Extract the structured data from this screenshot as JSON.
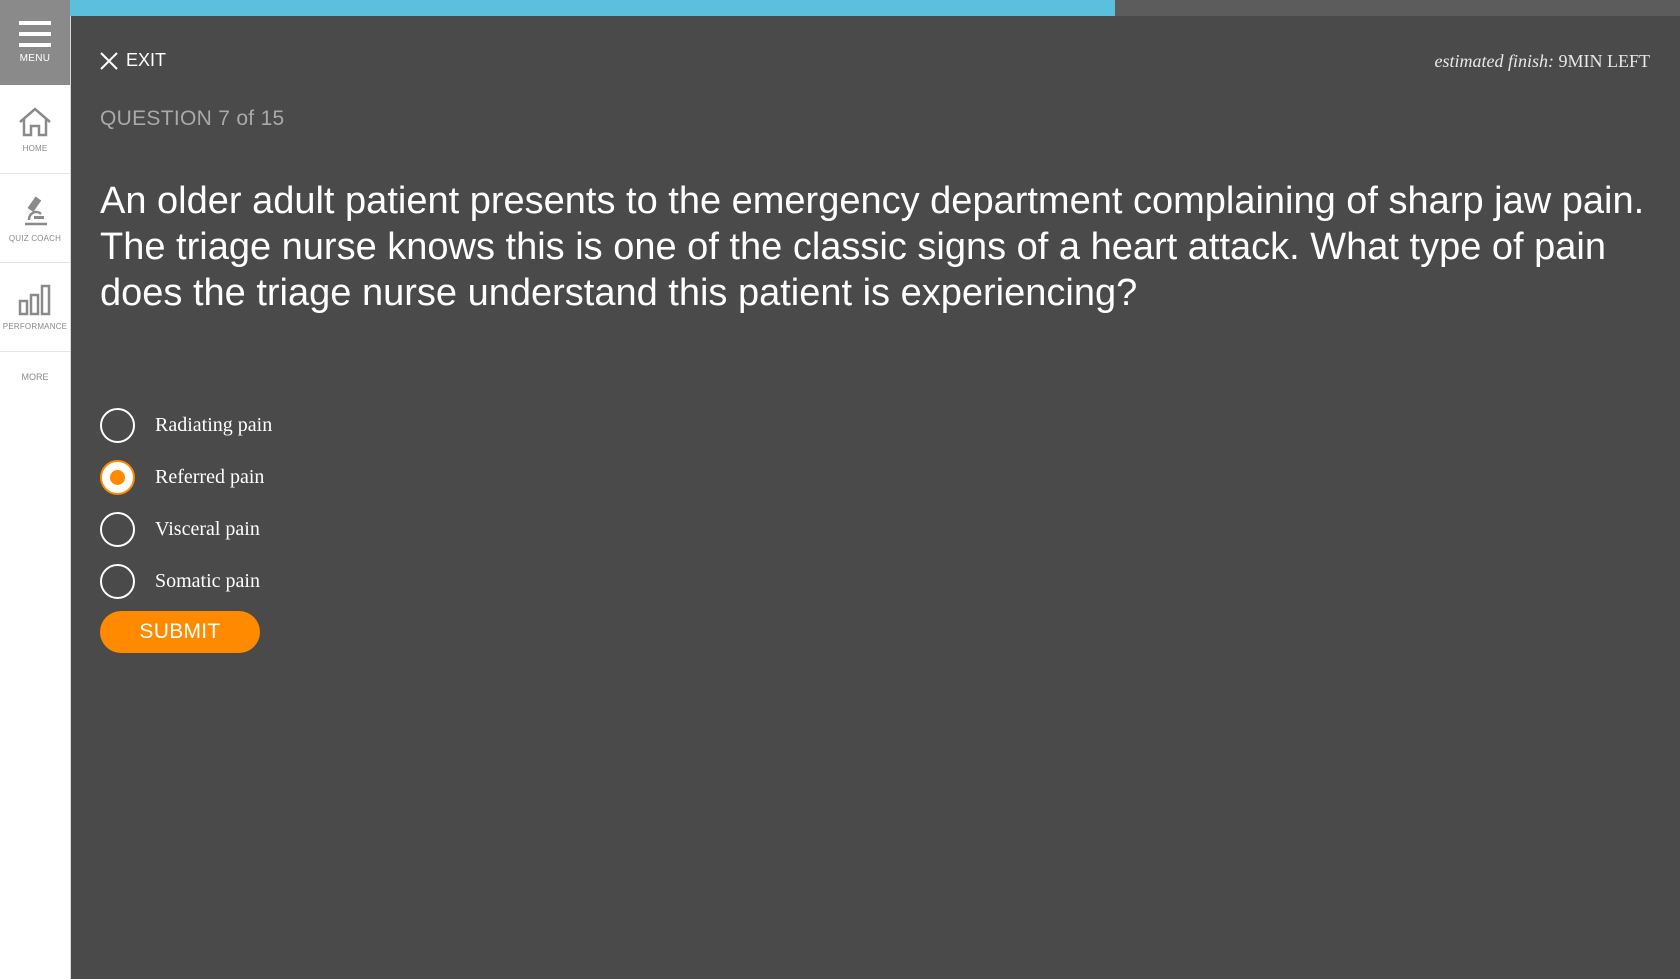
{
  "sidebar": {
    "menu_label": "MENU",
    "items": [
      {
        "label": "HOME",
        "icon": "home-icon"
      },
      {
        "label": "QUIZ COACH",
        "icon": "microscope-icon"
      },
      {
        "label": "PERFORMANCE",
        "icon": "bar-chart-icon"
      }
    ],
    "more_label": "MORE"
  },
  "progress": {
    "fraction": 0.649,
    "fill_color": "#5bc0de"
  },
  "header": {
    "exit_label": "EXIT",
    "estimate_prefix": "estimated finish:",
    "estimate_value": "9MIN LEFT"
  },
  "question": {
    "number_label": "QUESTION 7 of 15",
    "text": "An older adult patient presents to the emergency department complaining of sharp jaw pain. The triage nurse knows this is one of the classic signs of a heart attack. What type of pain does the triage nurse understand this patient is experiencing?"
  },
  "options": [
    {
      "label": "Radiating pain",
      "selected": false
    },
    {
      "label": "Referred pain",
      "selected": true
    },
    {
      "label": "Visceral pain",
      "selected": false
    },
    {
      "label": "Somatic pain",
      "selected": false
    }
  ],
  "submit_label": "SUBMIT",
  "colors": {
    "accent": "#ff8a00",
    "background": "#4a4a4a",
    "progress": "#5bc0de"
  }
}
